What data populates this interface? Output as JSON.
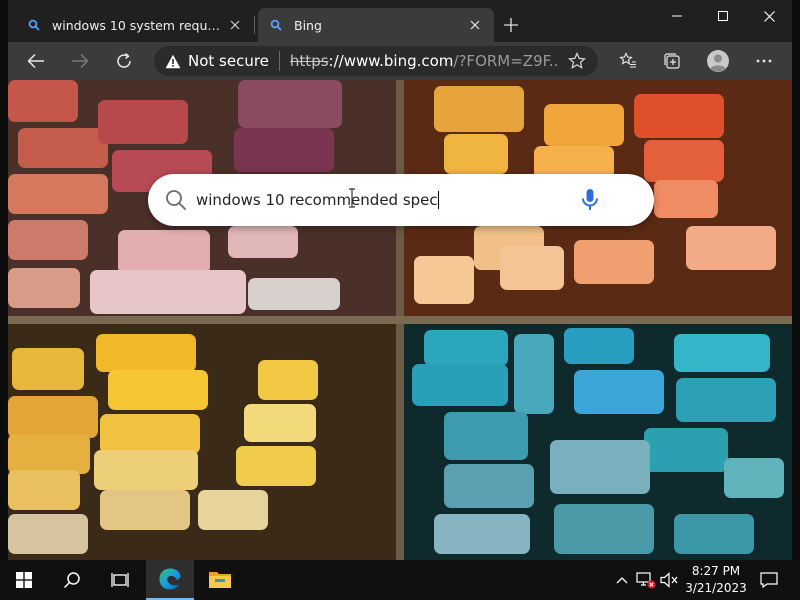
{
  "tabs": [
    {
      "title": "windows 10 system requirements - Search",
      "favicon": "search-icon",
      "active": false
    },
    {
      "title": "Bing",
      "favicon": "search-icon",
      "active": true
    }
  ],
  "toolbar": {
    "security_label": "Not secure",
    "url_scheme": "https",
    "url_host": "://www.bing.com",
    "url_path": "/?FORM=Z9F..."
  },
  "search": {
    "query": "windows 10 recommended spec"
  },
  "taskbar": {
    "time": "8:27 PM",
    "date": "3/21/2023",
    "pinned": [
      "start-icon",
      "search-icon",
      "task-view-icon",
      "edge-icon",
      "file-explorer-icon"
    ]
  },
  "colors": {
    "accent": "#76b9ed",
    "bing_mic": "#2f6fd6",
    "tab_active": "#3b3b3b",
    "chrome": "#202020"
  }
}
